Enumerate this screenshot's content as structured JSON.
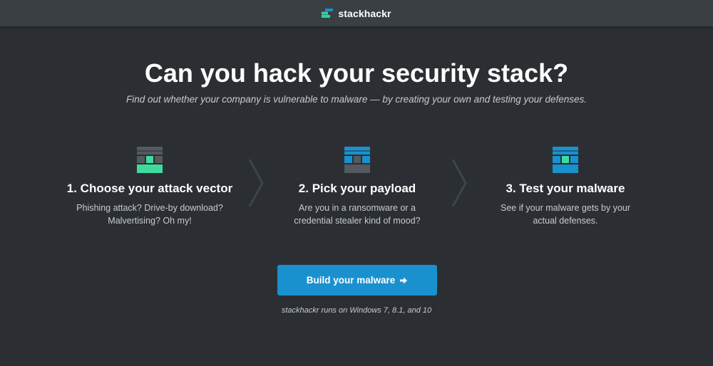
{
  "brand": {
    "name": "stackhackr",
    "logo_icon": "stack-logo-icon",
    "logo_colors": [
      "#2fd3a0",
      "#1a91cf"
    ]
  },
  "hero": {
    "title": "Can you hack your security stack?",
    "subtitle": "Find out whether your company is vulnerable to malware — by creating your own and testing your defenses."
  },
  "steps": [
    {
      "title": "1. Choose your attack vector",
      "desc_line1": "Phishing attack? Drive-by download?",
      "desc_line2": "Malvertising? Oh my!",
      "icon": "vector-stack-icon"
    },
    {
      "title": "2. Pick your payload",
      "desc_line1": "Are you in a ransomware or a",
      "desc_line2": "credential stealer kind of mood?",
      "icon": "payload-stack-icon"
    },
    {
      "title": "3. Test your malware",
      "desc_line1": "See if your malware gets by your",
      "desc_line2": "actual defenses.",
      "icon": "test-stack-icon"
    }
  ],
  "cta": {
    "label": "Build your malware",
    "icon": "arrow-right-icon"
  },
  "footnote": "stackhackr runs on Windows 7, 8.1, and 10",
  "colors": {
    "background": "#2b2f33",
    "topbar": "#3a3f44",
    "accent_green": "#3ddc9c",
    "accent_blue": "#1a91cf",
    "block_gray": "#555a60"
  }
}
